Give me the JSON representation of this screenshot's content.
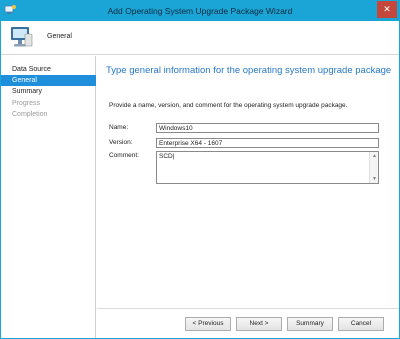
{
  "window": {
    "title": "Add Operating System Upgrade Package Wizard",
    "close_glyph": "✕"
  },
  "header": {
    "title": "General"
  },
  "nav": {
    "items": [
      {
        "label": "Data Source",
        "state": "normal"
      },
      {
        "label": "General",
        "state": "selected"
      },
      {
        "label": "Summary",
        "state": "normal"
      },
      {
        "label": "Progress",
        "state": "disabled"
      },
      {
        "label": "Completion",
        "state": "disabled"
      }
    ]
  },
  "main": {
    "heading": "Type general information for the operating system upgrade package",
    "description": "Provide a name, version, and comment for the operating system upgrade package.",
    "fields": {
      "name": {
        "label": "Name:",
        "value": "Windows10"
      },
      "version": {
        "label": "Version:",
        "value": "Enterprise X64 - 1607"
      },
      "comment": {
        "label": "Comment:",
        "value": "SCD|"
      }
    }
  },
  "footer": {
    "previous": "< Previous",
    "next": "Next >",
    "summary": "Summary",
    "cancel": "Cancel"
  },
  "colors": {
    "titlebar": "#1aa5d6",
    "heading": "#2878c8",
    "nav_selected": "#1f8fdc",
    "close": "#c5473c"
  },
  "icons": {
    "app": "wizard-app-icon",
    "header": "computer-monitor-icon",
    "close": "close-icon",
    "scroll_up": "chevron-up-icon",
    "scroll_down": "chevron-down-icon"
  }
}
